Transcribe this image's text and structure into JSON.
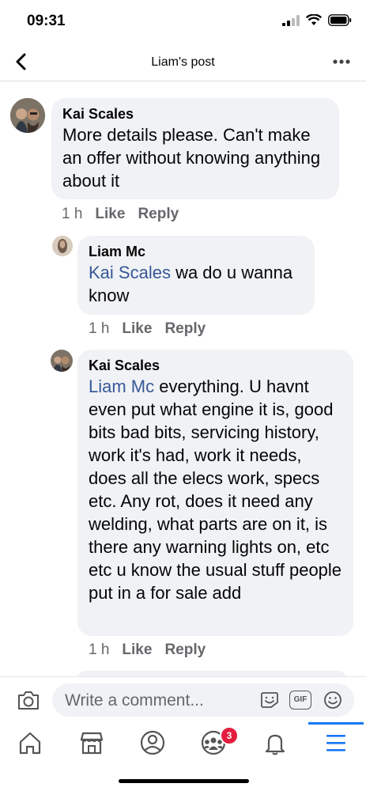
{
  "status_bar": {
    "time": "09:31"
  },
  "nav": {
    "title": "Liam's post"
  },
  "comments": [
    {
      "author": "Kai Scales",
      "mention": "",
      "text": "More details please. Can't make an offer without knowing anything about it",
      "time": "1 h",
      "like": "Like",
      "reply": "Reply"
    },
    {
      "author": "Liam Mc",
      "mention": "Kai Scales",
      "text": " wa do u wanna know",
      "time": "1 h",
      "like": "Like",
      "reply": "Reply"
    },
    {
      "author": "Kai Scales",
      "mention": "Liam Mc",
      "text": " everything. U havnt even put what engine it is, good bits bad bits, servicing history, work it's had, work it needs, does all the elecs work, specs etc. Any rot, does it need any welding, what parts are on it, is there any warning lights on, etc etc u know the usual stuff people put in a for sale add",
      "time": "1 h",
      "like": "Like",
      "reply": "Reply"
    }
  ],
  "composer": {
    "placeholder": "Write a comment...",
    "gif_label": "GIF"
  },
  "tab_bar": {
    "items": [
      "home-icon",
      "marketplace-icon",
      "profile-icon",
      "groups-icon",
      "notifications-icon",
      "menu-icon"
    ],
    "groups_badge": "3",
    "accent": "#1877f2",
    "badge_color": "#e41e3f"
  },
  "colors": {
    "mention": "#385898",
    "bubble": "#f0f2f5",
    "meta": "#65676b"
  }
}
